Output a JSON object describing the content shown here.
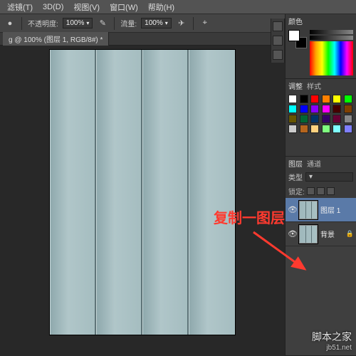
{
  "menu": {
    "items": [
      "滤镜(T)",
      "3D(D)",
      "视图(V)",
      "窗口(W)",
      "帮助(H)"
    ]
  },
  "options": {
    "opacity_label": "不透明度:",
    "opacity_value": "100%",
    "flow_label": "流量:",
    "flow_value": "100%"
  },
  "doc_tab": "g @ 100% (图层 1, RGB/8#) *",
  "panels": {
    "color_tab": "颜色",
    "adjust_tab": "调整",
    "styles_tab": "样式",
    "layers_tab": "图层",
    "channels_tab": "通道",
    "kind_label": "类型",
    "lock_label": "锁定:",
    "layers": [
      {
        "name": "图层 1",
        "selected": true,
        "locked": false
      },
      {
        "name": "背景",
        "selected": false,
        "locked": true
      }
    ]
  },
  "swatch_colors": [
    "#fff",
    "#000",
    "#f00",
    "#ff8000",
    "#ff0",
    "#0f0",
    "#0ff",
    "#00f",
    "#80f",
    "#f0f",
    "#400",
    "#804000",
    "#665500",
    "#063",
    "#036",
    "#306",
    "#603",
    "#888",
    "#ccc",
    "#b5651d",
    "#ffd27f",
    "#7fff7f",
    "#7fffff",
    "#7f7fff"
  ],
  "annotation": "复制一图层",
  "watermark": {
    "line1": "脚本之家",
    "line2": "jb51.net"
  }
}
